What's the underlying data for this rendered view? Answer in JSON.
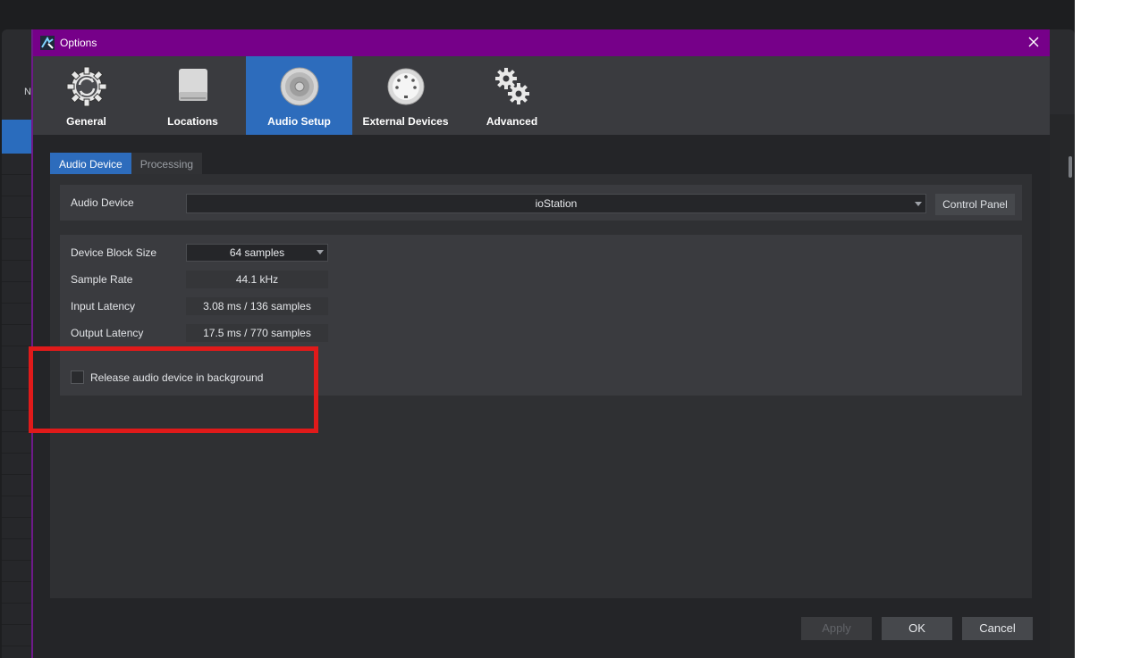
{
  "window": {
    "title": "Options",
    "close_icon": "close-icon"
  },
  "background": {
    "left_letter": "N"
  },
  "toolbar": {
    "items": [
      {
        "label": "General",
        "icon": "gear-refresh-icon"
      },
      {
        "label": "Locations",
        "icon": "drive-icon"
      },
      {
        "label": "Audio Setup",
        "icon": "speaker-icon",
        "active": true
      },
      {
        "label": "External Devices",
        "icon": "midi-port-icon"
      },
      {
        "label": "Advanced",
        "icon": "gears-icon"
      }
    ],
    "active_color": "#2d6cbc"
  },
  "tabs": [
    {
      "label": "Audio Device",
      "active": true
    },
    {
      "label": "Processing",
      "active": false
    }
  ],
  "audio_device": {
    "label": "Audio Device",
    "value": "ioStation",
    "control_panel_label": "Control Panel"
  },
  "settings": {
    "block_size_label": "Device Block Size",
    "block_size_value": "64 samples",
    "sample_rate_label": "Sample Rate",
    "sample_rate_value": "44.1 kHz",
    "input_latency_label": "Input Latency",
    "input_latency_value": "3.08 ms / 136 samples",
    "output_latency_label": "Output Latency",
    "output_latency_value": "17.5 ms / 770 samples",
    "release_label": "Release audio device in background",
    "release_checked": false
  },
  "buttons": {
    "apply": "Apply",
    "ok": "OK",
    "cancel": "Cancel"
  },
  "colors": {
    "titlebar": "#760089",
    "highlight": "#e01a1a"
  }
}
